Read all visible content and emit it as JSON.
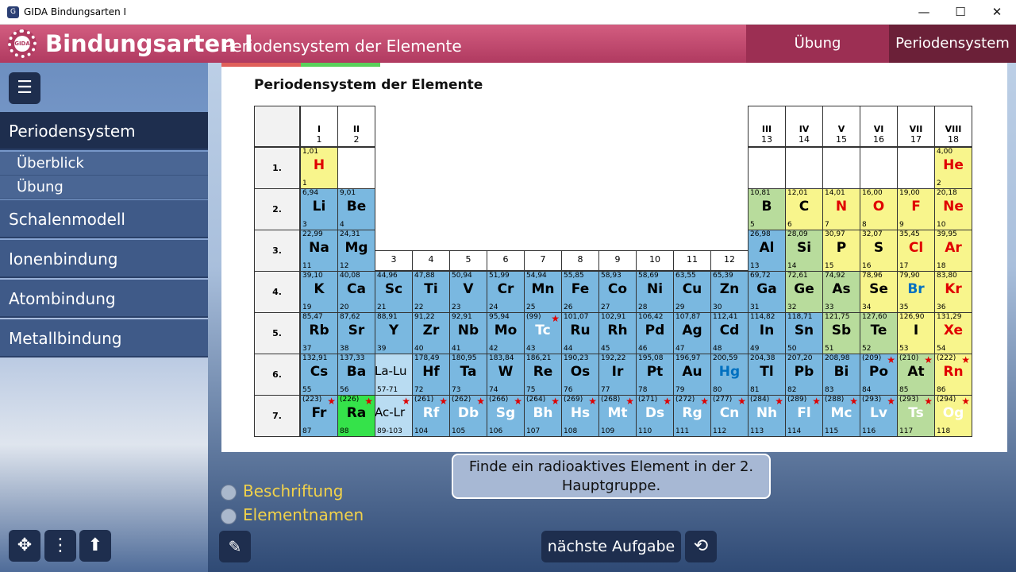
{
  "window": {
    "title": "GIDA Bindungsarten I",
    "minimize": "—",
    "maximize": "☐",
    "close": "✕"
  },
  "header": {
    "logo_text": "GIDA",
    "title": "Bindungsarten I",
    "subtitle": "Periodensystem der Elemente",
    "tab_uebung": "Übung",
    "tab_periodensystem": "Periodensystem"
  },
  "sidebar": {
    "menu_icon": "☰",
    "items": [
      {
        "label": "Periodensystem",
        "type": "main",
        "active": true
      },
      {
        "label": "Überblick",
        "type": "sub"
      },
      {
        "label": "Übung",
        "type": "sub"
      },
      {
        "label": "Schalenmodell",
        "type": "main"
      },
      {
        "label": "Ionenbindung",
        "type": "main"
      },
      {
        "label": "Atombindung",
        "type": "main"
      },
      {
        "label": "Metallbindung",
        "type": "main"
      }
    ],
    "bottom_icons": [
      "move-icon",
      "more-icon",
      "arrow-up-icon"
    ]
  },
  "card": {
    "title": "Periodensystem der Elemente"
  },
  "table": {
    "group_headers": [
      {
        "roman": "I",
        "num": "1"
      },
      {
        "roman": "II",
        "num": "2"
      },
      {
        "roman": "",
        "num": "3"
      },
      {
        "roman": "",
        "num": "4"
      },
      {
        "roman": "",
        "num": "5"
      },
      {
        "roman": "",
        "num": "6"
      },
      {
        "roman": "",
        "num": "7"
      },
      {
        "roman": "",
        "num": "8"
      },
      {
        "roman": "",
        "num": "9"
      },
      {
        "roman": "",
        "num": "10"
      },
      {
        "roman": "",
        "num": "11"
      },
      {
        "roman": "",
        "num": "12"
      },
      {
        "roman": "III",
        "num": "13"
      },
      {
        "roman": "IV",
        "num": "14"
      },
      {
        "roman": "V",
        "num": "15"
      },
      {
        "roman": "VI",
        "num": "16"
      },
      {
        "roman": "VII",
        "num": "17"
      },
      {
        "roman": "VIII",
        "num": "18"
      }
    ],
    "periods": [
      "1.",
      "2.",
      "3.",
      "4.",
      "5.",
      "6.",
      "7."
    ],
    "colors": {
      "metal": "#7ab8e0",
      "metal_light": "#b9dcf2",
      "semimetal": "#b8dc9c",
      "nonmetal": "#f8f58c",
      "highlight": "#35e24a",
      "red_text": "#e00000",
      "blue_text": "#0070c0",
      "white_text": "#ffffff",
      "star": "#dd0000"
    },
    "elements": [
      {
        "p": 1,
        "g": 1,
        "s": "H",
        "m": "1,01",
        "n": "1",
        "c": "nonmetal",
        "t": "red"
      },
      {
        "p": 1,
        "g": 18,
        "s": "He",
        "m": "4,00",
        "n": "2",
        "c": "nonmetal",
        "t": "red"
      },
      {
        "p": 2,
        "g": 1,
        "s": "Li",
        "m": "6,94",
        "n": "3",
        "c": "metal"
      },
      {
        "p": 2,
        "g": 2,
        "s": "Be",
        "m": "9,01",
        "n": "4",
        "c": "metal"
      },
      {
        "p": 2,
        "g": 13,
        "s": "B",
        "m": "10,81",
        "n": "5",
        "c": "semimetal"
      },
      {
        "p": 2,
        "g": 14,
        "s": "C",
        "m": "12,01",
        "n": "6",
        "c": "nonmetal"
      },
      {
        "p": 2,
        "g": 15,
        "s": "N",
        "m": "14,01",
        "n": "7",
        "c": "nonmetal",
        "t": "red"
      },
      {
        "p": 2,
        "g": 16,
        "s": "O",
        "m": "16,00",
        "n": "8",
        "c": "nonmetal",
        "t": "red"
      },
      {
        "p": 2,
        "g": 17,
        "s": "F",
        "m": "19,00",
        "n": "9",
        "c": "nonmetal",
        "t": "red"
      },
      {
        "p": 2,
        "g": 18,
        "s": "Ne",
        "m": "20,18",
        "n": "10",
        "c": "nonmetal",
        "t": "red"
      },
      {
        "p": 3,
        "g": 1,
        "s": "Na",
        "m": "22,99",
        "n": "11",
        "c": "metal"
      },
      {
        "p": 3,
        "g": 2,
        "s": "Mg",
        "m": "24,31",
        "n": "12",
        "c": "metal"
      },
      {
        "p": 3,
        "g": 13,
        "s": "Al",
        "m": "26,98",
        "n": "13",
        "c": "metal"
      },
      {
        "p": 3,
        "g": 14,
        "s": "Si",
        "m": "28,09",
        "n": "14",
        "c": "semimetal"
      },
      {
        "p": 3,
        "g": 15,
        "s": "P",
        "m": "30,97",
        "n": "15",
        "c": "nonmetal"
      },
      {
        "p": 3,
        "g": 16,
        "s": "S",
        "m": "32,07",
        "n": "16",
        "c": "nonmetal"
      },
      {
        "p": 3,
        "g": 17,
        "s": "Cl",
        "m": "35,45",
        "n": "17",
        "c": "nonmetal",
        "t": "red"
      },
      {
        "p": 3,
        "g": 18,
        "s": "Ar",
        "m": "39,95",
        "n": "18",
        "c": "nonmetal",
        "t": "red"
      },
      {
        "p": 4,
        "g": 1,
        "s": "K",
        "m": "39,10",
        "n": "19",
        "c": "metal"
      },
      {
        "p": 4,
        "g": 2,
        "s": "Ca",
        "m": "40,08",
        "n": "20",
        "c": "metal"
      },
      {
        "p": 4,
        "g": 3,
        "s": "Sc",
        "m": "44,96",
        "n": "21",
        "c": "metal"
      },
      {
        "p": 4,
        "g": 4,
        "s": "Ti",
        "m": "47,88",
        "n": "22",
        "c": "metal"
      },
      {
        "p": 4,
        "g": 5,
        "s": "V",
        "m": "50,94",
        "n": "23",
        "c": "metal"
      },
      {
        "p": 4,
        "g": 6,
        "s": "Cr",
        "m": "51,99",
        "n": "24",
        "c": "metal"
      },
      {
        "p": 4,
        "g": 7,
        "s": "Mn",
        "m": "54,94",
        "n": "25",
        "c": "metal"
      },
      {
        "p": 4,
        "g": 8,
        "s": "Fe",
        "m": "55,85",
        "n": "26",
        "c": "metal"
      },
      {
        "p": 4,
        "g": 9,
        "s": "Co",
        "m": "58,93",
        "n": "27",
        "c": "metal"
      },
      {
        "p": 4,
        "g": 10,
        "s": "Ni",
        "m": "58,69",
        "n": "28",
        "c": "metal"
      },
      {
        "p": 4,
        "g": 11,
        "s": "Cu",
        "m": "63,55",
        "n": "29",
        "c": "metal"
      },
      {
        "p": 4,
        "g": 12,
        "s": "Zn",
        "m": "65,39",
        "n": "30",
        "c": "metal"
      },
      {
        "p": 4,
        "g": 13,
        "s": "Ga",
        "m": "69,72",
        "n": "31",
        "c": "metal"
      },
      {
        "p": 4,
        "g": 14,
        "s": "Ge",
        "m": "72,61",
        "n": "32",
        "c": "semimetal"
      },
      {
        "p": 4,
        "g": 15,
        "s": "As",
        "m": "74,92",
        "n": "33",
        "c": "semimetal"
      },
      {
        "p": 4,
        "g": 16,
        "s": "Se",
        "m": "78,96",
        "n": "34",
        "c": "nonmetal"
      },
      {
        "p": 4,
        "g": 17,
        "s": "Br",
        "m": "79,90",
        "n": "35",
        "c": "nonmetal",
        "t": "blue"
      },
      {
        "p": 4,
        "g": 18,
        "s": "Kr",
        "m": "83,80",
        "n": "36",
        "c": "nonmetal",
        "t": "red"
      },
      {
        "p": 5,
        "g": 1,
        "s": "Rb",
        "m": "85,47",
        "n": "37",
        "c": "metal"
      },
      {
        "p": 5,
        "g": 2,
        "s": "Sr",
        "m": "87,62",
        "n": "38",
        "c": "metal"
      },
      {
        "p": 5,
        "g": 3,
        "s": "Y",
        "m": "88,91",
        "n": "39",
        "c": "metal"
      },
      {
        "p": 5,
        "g": 4,
        "s": "Zr",
        "m": "91,22",
        "n": "40",
        "c": "metal"
      },
      {
        "p": 5,
        "g": 5,
        "s": "Nb",
        "m": "92,91",
        "n": "41",
        "c": "metal"
      },
      {
        "p": 5,
        "g": 6,
        "s": "Mo",
        "m": "95,94",
        "n": "42",
        "c": "metal"
      },
      {
        "p": 5,
        "g": 7,
        "s": "Tc",
        "m": "(99)",
        "n": "43",
        "c": "metal",
        "t": "white",
        "r": true
      },
      {
        "p": 5,
        "g": 8,
        "s": "Ru",
        "m": "101,07",
        "n": "44",
        "c": "metal"
      },
      {
        "p": 5,
        "g": 9,
        "s": "Rh",
        "m": "102,91",
        "n": "45",
        "c": "metal"
      },
      {
        "p": 5,
        "g": 10,
        "s": "Pd",
        "m": "106,42",
        "n": "46",
        "c": "metal"
      },
      {
        "p": 5,
        "g": 11,
        "s": "Ag",
        "m": "107,87",
        "n": "47",
        "c": "metal"
      },
      {
        "p": 5,
        "g": 12,
        "s": "Cd",
        "m": "112,41",
        "n": "48",
        "c": "metal"
      },
      {
        "p": 5,
        "g": 13,
        "s": "In",
        "m": "114,82",
        "n": "49",
        "c": "metal"
      },
      {
        "p": 5,
        "g": 14,
        "s": "Sn",
        "m": "118,71",
        "n": "50",
        "c": "metal"
      },
      {
        "p": 5,
        "g": 15,
        "s": "Sb",
        "m": "121,75",
        "n": "51",
        "c": "semimetal"
      },
      {
        "p": 5,
        "g": 16,
        "s": "Te",
        "m": "127,60",
        "n": "52",
        "c": "semimetal"
      },
      {
        "p": 5,
        "g": 17,
        "s": "I",
        "m": "126,90",
        "n": "53",
        "c": "nonmetal"
      },
      {
        "p": 5,
        "g": 18,
        "s": "Xe",
        "m": "131,29",
        "n": "54",
        "c": "nonmetal",
        "t": "red"
      },
      {
        "p": 6,
        "g": 1,
        "s": "Cs",
        "m": "132,91",
        "n": "55",
        "c": "metal"
      },
      {
        "p": 6,
        "g": 2,
        "s": "Ba",
        "m": "137,33",
        "n": "56",
        "c": "metal"
      },
      {
        "p": 6,
        "g": 3,
        "s": "La-Lu",
        "m": "",
        "n": "57-71",
        "c": "metal_light",
        "small": true
      },
      {
        "p": 6,
        "g": 4,
        "s": "Hf",
        "m": "178,49",
        "n": "72",
        "c": "metal"
      },
      {
        "p": 6,
        "g": 5,
        "s": "Ta",
        "m": "180,95",
        "n": "73",
        "c": "metal"
      },
      {
        "p": 6,
        "g": 6,
        "s": "W",
        "m": "183,84",
        "n": "74",
        "c": "metal"
      },
      {
        "p": 6,
        "g": 7,
        "s": "Re",
        "m": "186,21",
        "n": "75",
        "c": "metal"
      },
      {
        "p": 6,
        "g": 8,
        "s": "Os",
        "m": "190,23",
        "n": "76",
        "c": "metal"
      },
      {
        "p": 6,
        "g": 9,
        "s": "Ir",
        "m": "192,22",
        "n": "77",
        "c": "metal"
      },
      {
        "p": 6,
        "g": 10,
        "s": "Pt",
        "m": "195,08",
        "n": "78",
        "c": "metal"
      },
      {
        "p": 6,
        "g": 11,
        "s": "Au",
        "m": "196,97",
        "n": "79",
        "c": "metal"
      },
      {
        "p": 6,
        "g": 12,
        "s": "Hg",
        "m": "200,59",
        "n": "80",
        "c": "metal",
        "t": "blue"
      },
      {
        "p": 6,
        "g": 13,
        "s": "Tl",
        "m": "204,38",
        "n": "81",
        "c": "metal"
      },
      {
        "p": 6,
        "g": 14,
        "s": "Pb",
        "m": "207,20",
        "n": "82",
        "c": "metal"
      },
      {
        "p": 6,
        "g": 15,
        "s": "Bi",
        "m": "208,98",
        "n": "83",
        "c": "metal"
      },
      {
        "p": 6,
        "g": 16,
        "s": "Po",
        "m": "(209)",
        "n": "84",
        "c": "metal",
        "r": true
      },
      {
        "p": 6,
        "g": 17,
        "s": "At",
        "m": "(210)",
        "n": "85",
        "c": "semimetal",
        "r": true
      },
      {
        "p": 6,
        "g": 18,
        "s": "Rn",
        "m": "(222)",
        "n": "86",
        "c": "nonmetal",
        "t": "red",
        "r": true
      },
      {
        "p": 7,
        "g": 1,
        "s": "Fr",
        "m": "(223)",
        "n": "87",
        "c": "metal",
        "r": true
      },
      {
        "p": 7,
        "g": 2,
        "s": "Ra",
        "m": "(226)",
        "n": "88",
        "c": "highlight",
        "r": true
      },
      {
        "p": 7,
        "g": 3,
        "s": "Ac-Lr",
        "m": "",
        "n": "89-103",
        "c": "metal_light",
        "small": true,
        "r": true
      },
      {
        "p": 7,
        "g": 4,
        "s": "Rf",
        "m": "(261)",
        "n": "104",
        "c": "metal",
        "t": "white",
        "r": true
      },
      {
        "p": 7,
        "g": 5,
        "s": "Db",
        "m": "(262)",
        "n": "105",
        "c": "metal",
        "t": "white",
        "r": true
      },
      {
        "p": 7,
        "g": 6,
        "s": "Sg",
        "m": "(266)",
        "n": "106",
        "c": "metal",
        "t": "white",
        "r": true
      },
      {
        "p": 7,
        "g": 7,
        "s": "Bh",
        "m": "(264)",
        "n": "107",
        "c": "metal",
        "t": "white",
        "r": true
      },
      {
        "p": 7,
        "g": 8,
        "s": "Hs",
        "m": "(269)",
        "n": "108",
        "c": "metal",
        "t": "white",
        "r": true
      },
      {
        "p": 7,
        "g": 9,
        "s": "Mt",
        "m": "(268)",
        "n": "109",
        "c": "metal",
        "t": "white",
        "r": true
      },
      {
        "p": 7,
        "g": 10,
        "s": "Ds",
        "m": "(271)",
        "n": "110",
        "c": "metal",
        "t": "white",
        "r": true
      },
      {
        "p": 7,
        "g": 11,
        "s": "Rg",
        "m": "(272)",
        "n": "111",
        "c": "metal",
        "t": "white",
        "r": true
      },
      {
        "p": 7,
        "g": 12,
        "s": "Cn",
        "m": "(277)",
        "n": "112",
        "c": "metal",
        "t": "white",
        "r": true
      },
      {
        "p": 7,
        "g": 13,
        "s": "Nh",
        "m": "(284)",
        "n": "113",
        "c": "metal",
        "t": "white",
        "r": true
      },
      {
        "p": 7,
        "g": 14,
        "s": "Fl",
        "m": "(289)",
        "n": "114",
        "c": "metal",
        "t": "white",
        "r": true
      },
      {
        "p": 7,
        "g": 15,
        "s": "Mc",
        "m": "(288)",
        "n": "115",
        "c": "metal",
        "t": "white",
        "r": true
      },
      {
        "p": 7,
        "g": 16,
        "s": "Lv",
        "m": "(293)",
        "n": "116",
        "c": "metal",
        "t": "white",
        "r": true
      },
      {
        "p": 7,
        "g": 17,
        "s": "Ts",
        "m": "(293)",
        "n": "117",
        "c": "semimetal",
        "t": "white",
        "r": true
      },
      {
        "p": 7,
        "g": 18,
        "s": "Og",
        "m": "(294)",
        "n": "118",
        "c": "nonmetal",
        "t": "white",
        "r": true
      }
    ]
  },
  "instruction": "Finde ein radioaktives Element in der 2. Hauptgruppe.",
  "options": {
    "beschriftung": "Beschriftung",
    "elementnamen": "Elementnamen"
  },
  "buttons": {
    "next": "nächste Aufgabe",
    "reload_icon": "⟲",
    "edit_icon": "✎"
  }
}
